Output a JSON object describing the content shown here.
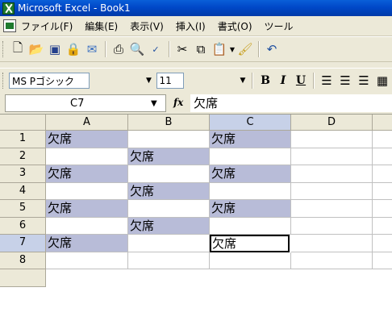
{
  "window": {
    "title": "Microsoft Excel - Book1"
  },
  "menu": [
    "ファイル(F)",
    "編集(E)",
    "表示(V)",
    "挿入(I)",
    "書式(O)",
    "ツール"
  ],
  "toolbar": {
    "icons": [
      "new-icon",
      "open-icon",
      "save-icon",
      "permission-icon",
      "email-icon",
      "print-icon",
      "print-preview-icon",
      "spelling-icon",
      "cut-icon",
      "copy-icon",
      "paste-icon",
      "format-painter-icon",
      "undo-icon"
    ]
  },
  "format": {
    "font": "MS Pゴシック",
    "size": "11",
    "bold": "B",
    "italic": "I",
    "underline": "U"
  },
  "formula": {
    "name_box": "C7",
    "fx": "fx",
    "value": "欠席"
  },
  "columns": [
    "A",
    "B",
    "C",
    "D"
  ],
  "rows": [
    {
      "num": "1",
      "A": "欠席",
      "B": "",
      "C": "欠席",
      "D": ""
    },
    {
      "num": "2",
      "A": "",
      "B": "欠席",
      "C": "",
      "D": ""
    },
    {
      "num": "3",
      "A": "欠席",
      "B": "",
      "C": "欠席",
      "D": ""
    },
    {
      "num": "4",
      "A": "",
      "B": "欠席",
      "C": "",
      "D": ""
    },
    {
      "num": "5",
      "A": "欠席",
      "B": "",
      "C": "欠席",
      "D": ""
    },
    {
      "num": "6",
      "A": "",
      "B": "欠席",
      "C": "",
      "D": ""
    },
    {
      "num": "7",
      "A": "欠席",
      "B": "",
      "C": "欠席",
      "D": ""
    },
    {
      "num": "8",
      "A": "",
      "B": "",
      "C": "",
      "D": ""
    }
  ],
  "active_cell": "C7",
  "colors": {
    "shaded_fill": "#b8bcd8",
    "title_bar": "#0048c8"
  }
}
